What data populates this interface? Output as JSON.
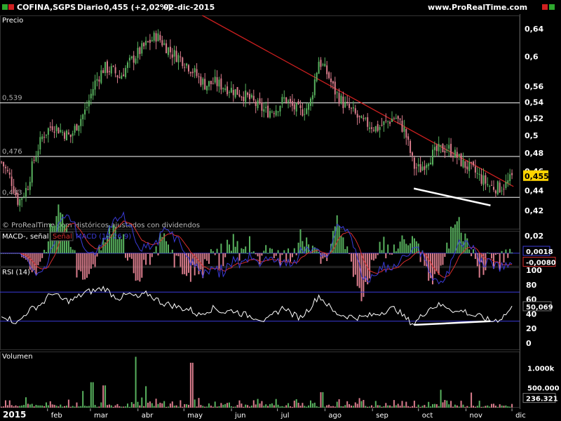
{
  "header": {
    "symbol": "COFINA,SGPS",
    "period": "Diario",
    "quote": "0,455 (+2,02%)",
    "date": "02-dic-2015",
    "site": "www.ProRealTime.com"
  },
  "colors": {
    "up": "#58b15e",
    "down": "#d97c8c",
    "trendline": "#cc1f1f",
    "macd": "#3b3bd9",
    "signal": "#d92e2e",
    "rsi_band": "#3b3bd9",
    "badge": "#ffd400",
    "green_icon": "#2ea82e",
    "red_icon": "#d02020"
  },
  "chart_data": [
    {
      "type": "candlestick",
      "panel": "price",
      "title": "Precio",
      "watermark": "© ProRealTime.com Históricos ajustados con dividendos",
      "ylim": [
        0.402,
        0.66
      ],
      "y_scale": "log",
      "y_ticks": [
        "0,64",
        "0,6",
        "0,56",
        "0,54",
        "0,52",
        "0,5",
        "0,48",
        "0,46",
        "0,44",
        "0,42"
      ],
      "y_tick_values": [
        0.64,
        0.6,
        0.56,
        0.54,
        0.52,
        0.5,
        0.48,
        0.46,
        0.44,
        0.42
      ],
      "x_ticks": [
        "2015",
        "feb",
        "mar",
        "abr",
        "may",
        "jun",
        "jul",
        "ago",
        "sep",
        "oct",
        "nov",
        "dic"
      ],
      "horizontal_levels": [
        {
          "label": "0,539",
          "value": 0.539
        },
        {
          "label": "0,476",
          "value": 0.476
        },
        {
          "label": "0,433",
          "value": 0.433
        }
      ],
      "last_value": {
        "label": "0,455",
        "value": 0.455
      },
      "trendline": {
        "from": [
          "2015-05-13",
          0.66
        ],
        "to": [
          "2015-12-02",
          0.444
        ]
      },
      "support_annotation": {
        "from": [
          "2015-09-28",
          0.442
        ],
        "to": [
          "2015-11-17",
          0.425
        ]
      },
      "close_path": [
        [
          "2015-01-02",
          0.47
        ],
        [
          "2015-01-08",
          0.452
        ],
        [
          "2015-01-13",
          0.428
        ],
        [
          "2015-01-19",
          0.444
        ],
        [
          "2015-01-23",
          0.472
        ],
        [
          "2015-01-29",
          0.5
        ],
        [
          "2015-02-04",
          0.512
        ],
        [
          "2015-02-10",
          0.505
        ],
        [
          "2015-02-16",
          0.498
        ],
        [
          "2015-02-20",
          0.512
        ],
        [
          "2015-02-26",
          0.53
        ],
        [
          "2015-03-04",
          0.565
        ],
        [
          "2015-03-10",
          0.585
        ],
        [
          "2015-03-16",
          0.58
        ],
        [
          "2015-03-20",
          0.572
        ],
        [
          "2015-03-26",
          0.59
        ],
        [
          "2015-04-01",
          0.605
        ],
        [
          "2015-04-07",
          0.618
        ],
        [
          "2015-04-13",
          0.63
        ],
        [
          "2015-04-17",
          0.62
        ],
        [
          "2015-04-23",
          0.605
        ],
        [
          "2015-04-29",
          0.598
        ],
        [
          "2015-05-05",
          0.585
        ],
        [
          "2015-05-11",
          0.57
        ],
        [
          "2015-05-15",
          0.562
        ],
        [
          "2015-05-21",
          0.565
        ],
        [
          "2015-05-27",
          0.56
        ],
        [
          "2015-06-02",
          0.555
        ],
        [
          "2015-06-08",
          0.55
        ],
        [
          "2015-06-12",
          0.545
        ],
        [
          "2015-06-18",
          0.535
        ],
        [
          "2015-06-24",
          0.528
        ],
        [
          "2015-06-30",
          0.532
        ],
        [
          "2015-07-06",
          0.545
        ],
        [
          "2015-07-10",
          0.535
        ],
        [
          "2015-07-16",
          0.528
        ],
        [
          "2015-07-22",
          0.535
        ],
        [
          "2015-07-28",
          0.595
        ],
        [
          "2015-08-03",
          0.575
        ],
        [
          "2015-08-07",
          0.555
        ],
        [
          "2015-08-13",
          0.538
        ],
        [
          "2015-08-19",
          0.528
        ],
        [
          "2015-08-25",
          0.515
        ],
        [
          "2015-08-31",
          0.512
        ],
        [
          "2015-09-04",
          0.508
        ],
        [
          "2015-09-10",
          0.515
        ],
        [
          "2015-09-16",
          0.522
        ],
        [
          "2015-09-22",
          0.505
        ],
        [
          "2015-09-28",
          0.465
        ],
        [
          "2015-10-02",
          0.462
        ],
        [
          "2015-10-08",
          0.475
        ],
        [
          "2015-10-14",
          0.483
        ],
        [
          "2015-10-20",
          0.486
        ],
        [
          "2015-10-26",
          0.476
        ],
        [
          "2015-10-30",
          0.468
        ],
        [
          "2015-11-05",
          0.462
        ],
        [
          "2015-11-11",
          0.452
        ],
        [
          "2015-11-17",
          0.444
        ],
        [
          "2015-11-23",
          0.443
        ],
        [
          "2015-11-27",
          0.446
        ],
        [
          "2015-12-02",
          0.455
        ]
      ]
    },
    {
      "type": "line",
      "panel": "macd",
      "title": "MACD-, señal",
      "legend": [
        "Señal",
        "MACD (12 26 9)"
      ],
      "ylim": [
        -0.012,
        0.02
      ],
      "y_ticks": [
        "0,02"
      ],
      "y_tick_values": [
        0.02
      ],
      "last_values": [
        {
          "label": "0,0018",
          "value": 0.0018
        },
        {
          "label": "-0,0080",
          "value": -0.008
        }
      ],
      "zero_line": 0.0
    },
    {
      "type": "line",
      "panel": "rsi",
      "title": "RSI (14)",
      "ylim": [
        0,
        100
      ],
      "y_ticks": [
        "100",
        "80",
        "60",
        "40",
        "20",
        "0"
      ],
      "y_tick_values": [
        100,
        80,
        60,
        40,
        20,
        0
      ],
      "bands": [
        70,
        30
      ],
      "last_value": {
        "label": "50,069",
        "value": 50.069
      },
      "support_annotation": {
        "from": [
          "2015-09-28",
          25
        ],
        "to": [
          "2015-11-17",
          30
        ]
      },
      "path": [
        [
          "2015-01-02",
          40
        ],
        [
          "2015-01-08",
          32
        ],
        [
          "2015-01-13",
          28
        ],
        [
          "2015-01-19",
          44
        ],
        [
          "2015-01-23",
          48
        ],
        [
          "2015-01-29",
          55
        ],
        [
          "2015-02-04",
          70
        ],
        [
          "2015-02-10",
          60
        ],
        [
          "2015-02-16",
          58
        ],
        [
          "2015-02-20",
          62
        ],
        [
          "2015-02-26",
          70
        ],
        [
          "2015-03-04",
          72
        ],
        [
          "2015-03-10",
          76
        ],
        [
          "2015-03-16",
          65
        ],
        [
          "2015-03-20",
          62
        ],
        [
          "2015-03-26",
          67
        ],
        [
          "2015-04-01",
          62
        ],
        [
          "2015-04-07",
          68
        ],
        [
          "2015-04-13",
          60
        ],
        [
          "2015-04-17",
          55
        ],
        [
          "2015-04-23",
          52
        ],
        [
          "2015-04-29",
          48
        ],
        [
          "2015-05-05",
          46
        ],
        [
          "2015-05-11",
          38
        ],
        [
          "2015-05-15",
          44
        ],
        [
          "2015-05-21",
          48
        ],
        [
          "2015-05-27",
          42
        ],
        [
          "2015-06-02",
          45
        ],
        [
          "2015-06-08",
          40
        ],
        [
          "2015-06-12",
          38
        ],
        [
          "2015-06-18",
          35
        ],
        [
          "2015-06-24",
          30
        ],
        [
          "2015-06-30",
          42
        ],
        [
          "2015-07-06",
          50
        ],
        [
          "2015-07-10",
          40
        ],
        [
          "2015-07-16",
          35
        ],
        [
          "2015-07-22",
          48
        ],
        [
          "2015-07-28",
          65
        ],
        [
          "2015-08-03",
          52
        ],
        [
          "2015-08-07",
          42
        ],
        [
          "2015-08-13",
          38
        ],
        [
          "2015-08-19",
          36
        ],
        [
          "2015-08-25",
          35
        ],
        [
          "2015-08-31",
          38
        ],
        [
          "2015-09-04",
          40
        ],
        [
          "2015-09-10",
          45
        ],
        [
          "2015-09-16",
          48
        ],
        [
          "2015-09-22",
          35
        ],
        [
          "2015-09-28",
          26
        ],
        [
          "2015-10-02",
          35
        ],
        [
          "2015-10-08",
          48
        ],
        [
          "2015-10-14",
          52
        ],
        [
          "2015-10-20",
          50
        ],
        [
          "2015-10-26",
          42
        ],
        [
          "2015-10-30",
          45
        ],
        [
          "2015-11-05",
          38
        ],
        [
          "2015-11-11",
          36
        ],
        [
          "2015-11-17",
          30
        ],
        [
          "2015-11-23",
          33
        ],
        [
          "2015-11-27",
          40
        ],
        [
          "2015-12-02",
          50.069
        ]
      ]
    },
    {
      "type": "bar",
      "panel": "volume",
      "title": "Volumen",
      "ylim": [
        0,
        1200000
      ],
      "y_ticks": [
        "1.000k",
        "500.000"
      ],
      "y_tick_values": [
        1000000,
        500000
      ],
      "last_value": {
        "label": "236.321",
        "value": 236321
      },
      "notable_bars": [
        [
          "2015-03-31",
          1280000
        ],
        [
          "2015-05-06",
          1130000
        ],
        [
          "2015-03-02",
          640000
        ],
        [
          "2015-03-10",
          560000
        ],
        [
          "2015-04-06",
          540000
        ],
        [
          "2015-02-24",
          420000
        ],
        [
          "2015-11-04",
          380000
        ],
        [
          "2015-07-30",
          390000
        ],
        [
          "2015-10-15",
          450000
        ]
      ]
    }
  ]
}
